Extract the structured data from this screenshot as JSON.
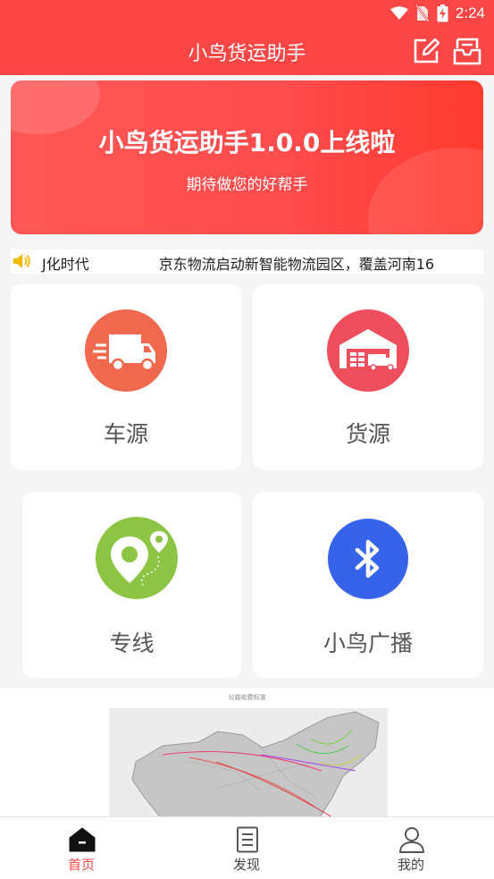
{
  "status_bar": {
    "time": "2:24"
  },
  "app_bar": {
    "title": "小鸟货运助手"
  },
  "banner": {
    "title": "小鸟货运助手1.0.0上线啦",
    "subtitle": "期待做您的好帮手"
  },
  "notice": {
    "text_part1": "J化时代",
    "text_part2": "京东物流启动新智能物流园区，覆盖河南16"
  },
  "menu": {
    "vehicle_source": "车源",
    "cargo_source": "货源",
    "dedicated_line": "专线",
    "broadcast": "小鸟广播"
  },
  "map": {
    "caption": "公路收费标准"
  },
  "bottom_nav": {
    "home": "首页",
    "discover": "发现",
    "mine": "我的"
  },
  "colors": {
    "primary": "#fb4646",
    "vehicle_icon": "#f0694e",
    "cargo_icon": "#ef4f5d",
    "line_icon": "#8cc443",
    "broadcast_icon": "#3563e9",
    "notice_icon": "#f5b800"
  }
}
